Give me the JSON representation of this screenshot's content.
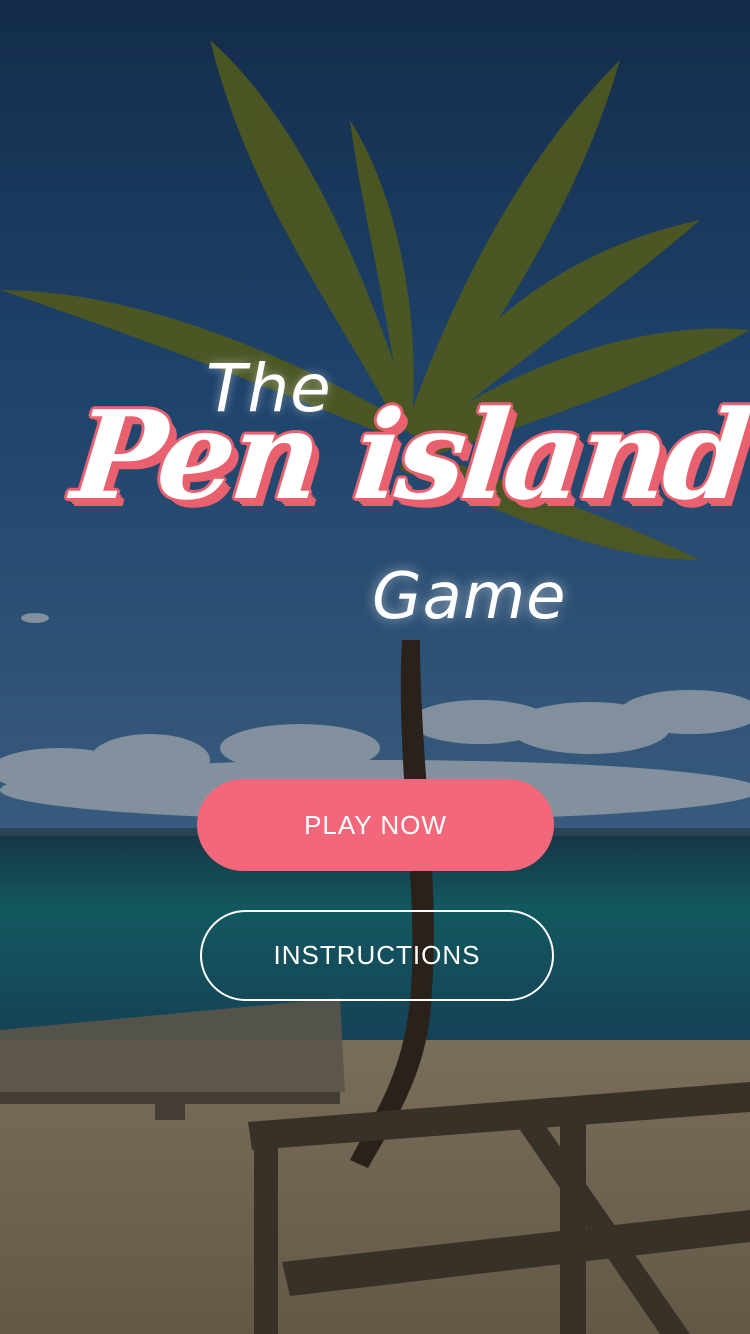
{
  "title": {
    "line1": "The",
    "line2": "Pen island",
    "line3": "Game"
  },
  "buttons": {
    "play": "PLAY NOW",
    "instructions": "INSTRUCTIONS"
  },
  "colors": {
    "accent": "#f2687a",
    "title_outline": "#e9606f",
    "text": "#ffffff",
    "sky_top": "#1d3f6a",
    "sea": "#1d7e86",
    "sand": "#b9a98d"
  },
  "background": {
    "scene": "beach-palm-tree"
  }
}
